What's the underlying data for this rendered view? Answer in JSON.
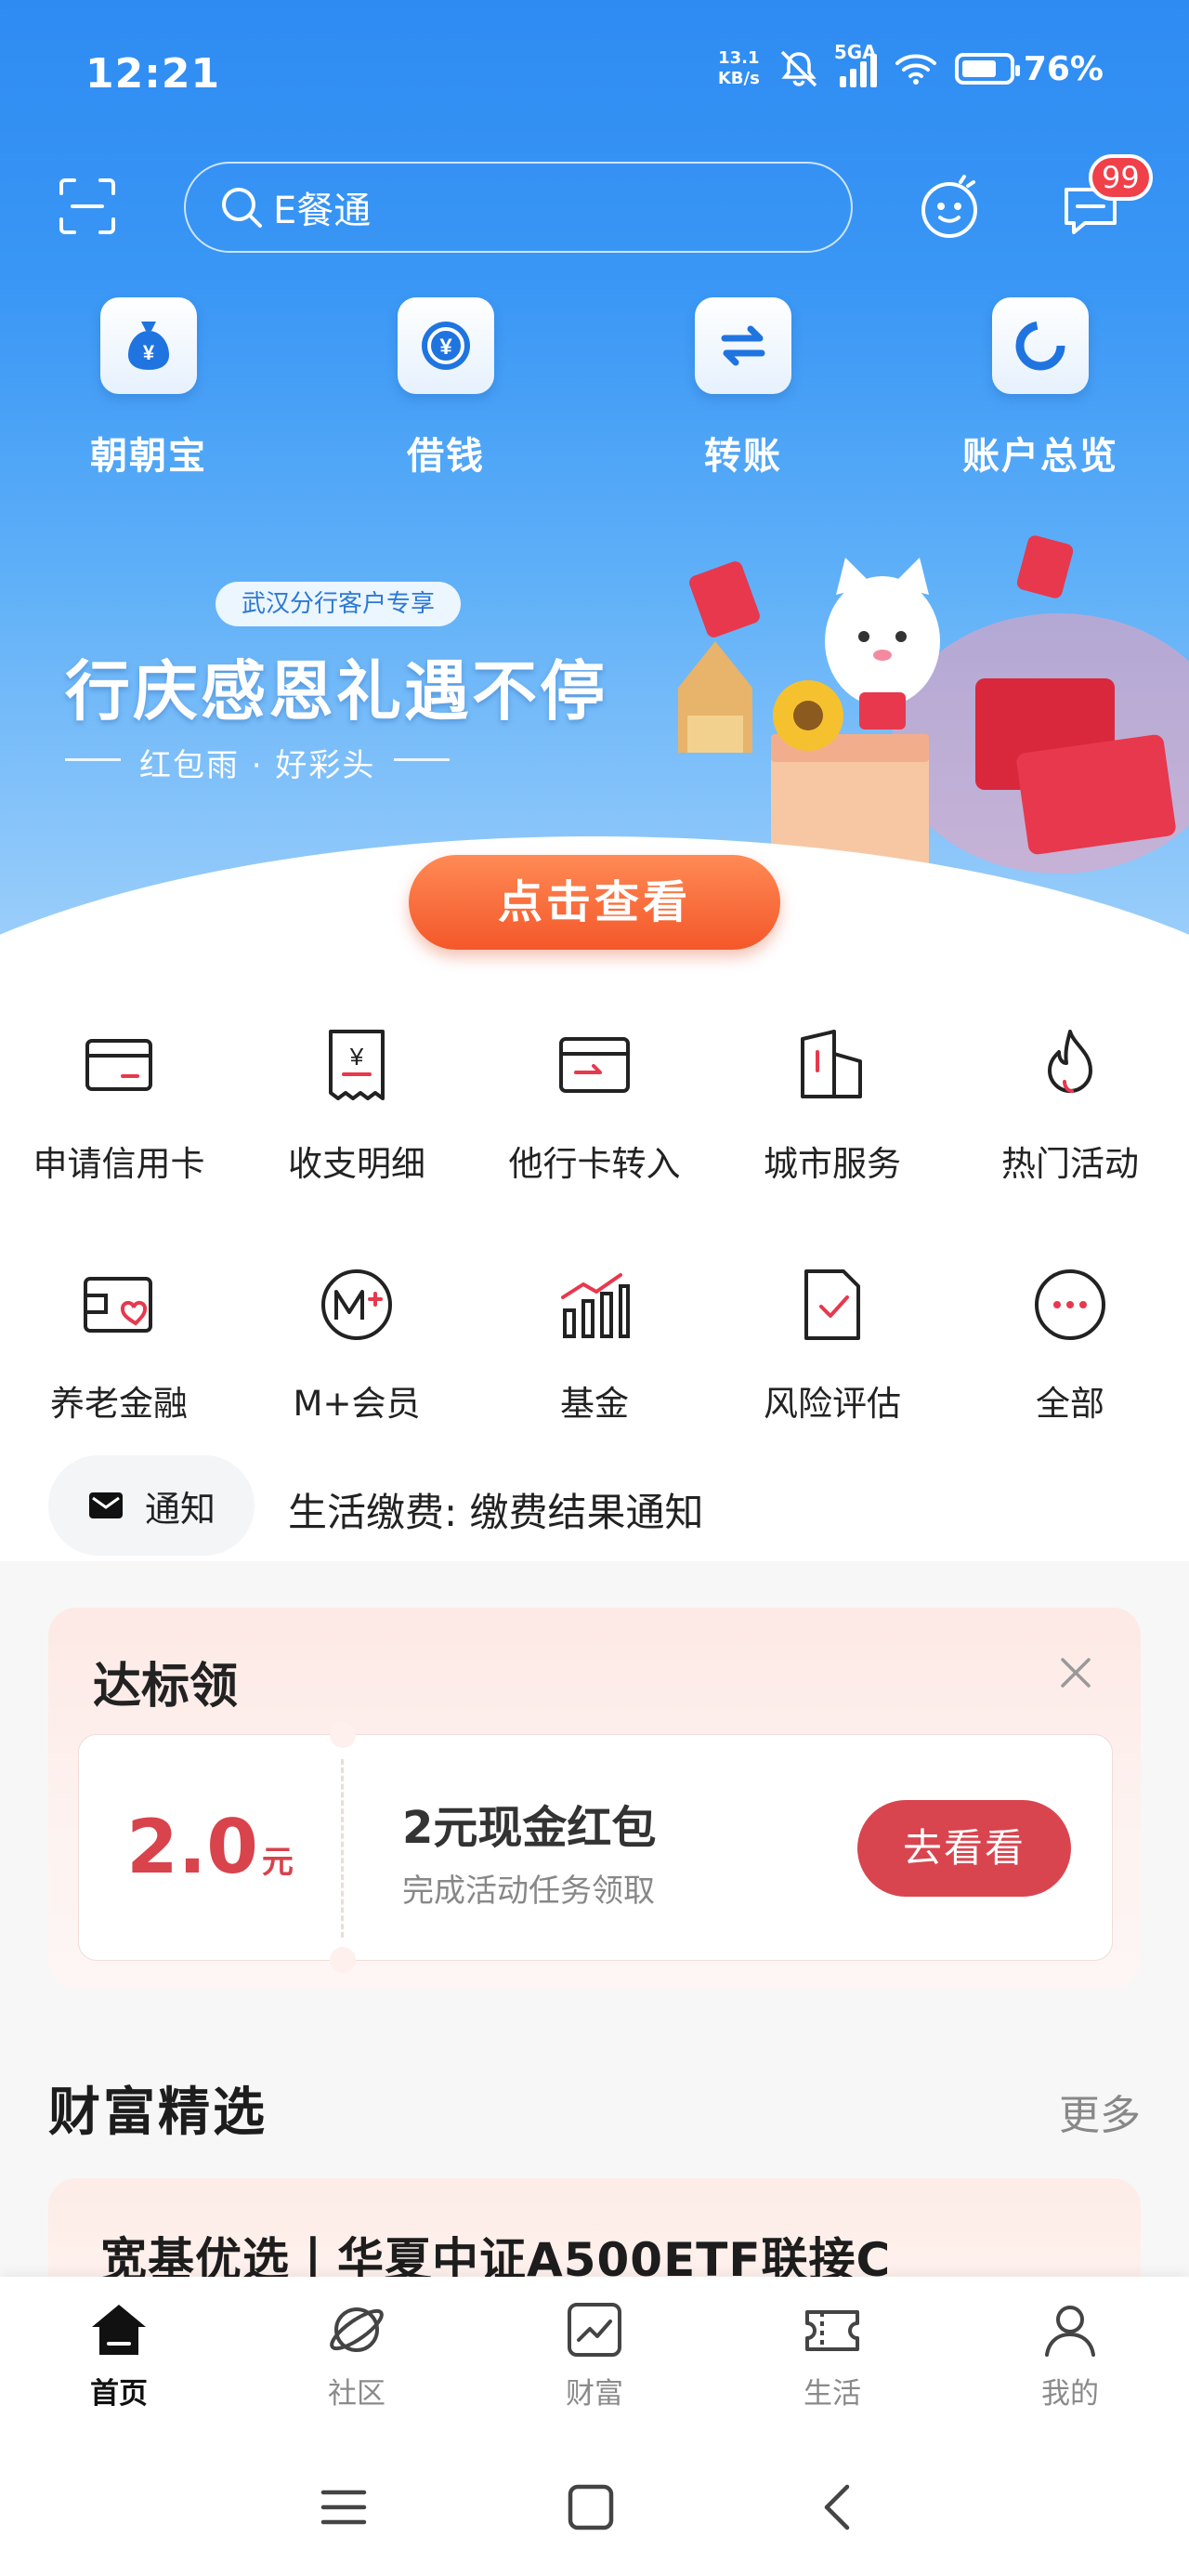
{
  "status_bar": {
    "time": "12:21",
    "net_speed_value": "13.1",
    "net_speed_unit": "KB/s",
    "network": "5GA",
    "battery": "76%",
    "battery_level": 0.76
  },
  "header": {
    "search_text": "E餐通",
    "message_badge": "99"
  },
  "quick_entries": [
    {
      "label": "朝朝宝",
      "icon": "money-bag-icon"
    },
    {
      "label": "借钱",
      "icon": "yen-coin-icon"
    },
    {
      "label": "转账",
      "icon": "transfer-arrows-icon"
    },
    {
      "label": "账户总览",
      "icon": "pie-ring-icon"
    }
  ],
  "promo": {
    "tag": "武汉分行客户专享",
    "title": "行庆感恩礼遇不停",
    "subtitle": "红包雨 · 好彩头",
    "button": "点击查看"
  },
  "features": [
    {
      "label": "申请信用卡",
      "icon": "credit-card-icon"
    },
    {
      "label": "收支明细",
      "icon": "receipt-icon"
    },
    {
      "label": "他行卡转入",
      "icon": "card-transfer-icon"
    },
    {
      "label": "城市服务",
      "icon": "city-building-icon"
    },
    {
      "label": "热门活动",
      "icon": "flame-icon"
    },
    {
      "label": "养老金融",
      "icon": "pension-card-icon"
    },
    {
      "label": "M+会员",
      "icon": "m-plus-icon"
    },
    {
      "label": "基金",
      "icon": "bar-chart-icon"
    },
    {
      "label": "风险评估",
      "icon": "checklist-icon"
    },
    {
      "label": "全部",
      "icon": "more-dots-icon"
    }
  ],
  "notice": {
    "pill_label": "通知",
    "text": "生活缴费: 缴费结果通知"
  },
  "reward": {
    "title": "达标领",
    "amount": "2.0",
    "unit": "元",
    "name": "2元现金红包",
    "desc": "完成活动任务领取",
    "button": "去看看"
  },
  "wealth": {
    "title": "财富精选",
    "more": "更多",
    "card_title": "宽基优选丨华夏中证A500ETF联接C"
  },
  "bottom_nav": [
    {
      "label": "首页",
      "icon": "home-icon",
      "active": true
    },
    {
      "label": "社区",
      "icon": "planet-icon",
      "active": false
    },
    {
      "label": "财富",
      "icon": "trend-chart-icon",
      "active": false
    },
    {
      "label": "生活",
      "icon": "ticket-icon",
      "active": false
    },
    {
      "label": "我的",
      "icon": "profile-icon",
      "active": false
    }
  ],
  "colors": {
    "brand_blue": "#2e8bf2",
    "accent_red": "#d9454f",
    "cta_orange": "#f4572a"
  }
}
